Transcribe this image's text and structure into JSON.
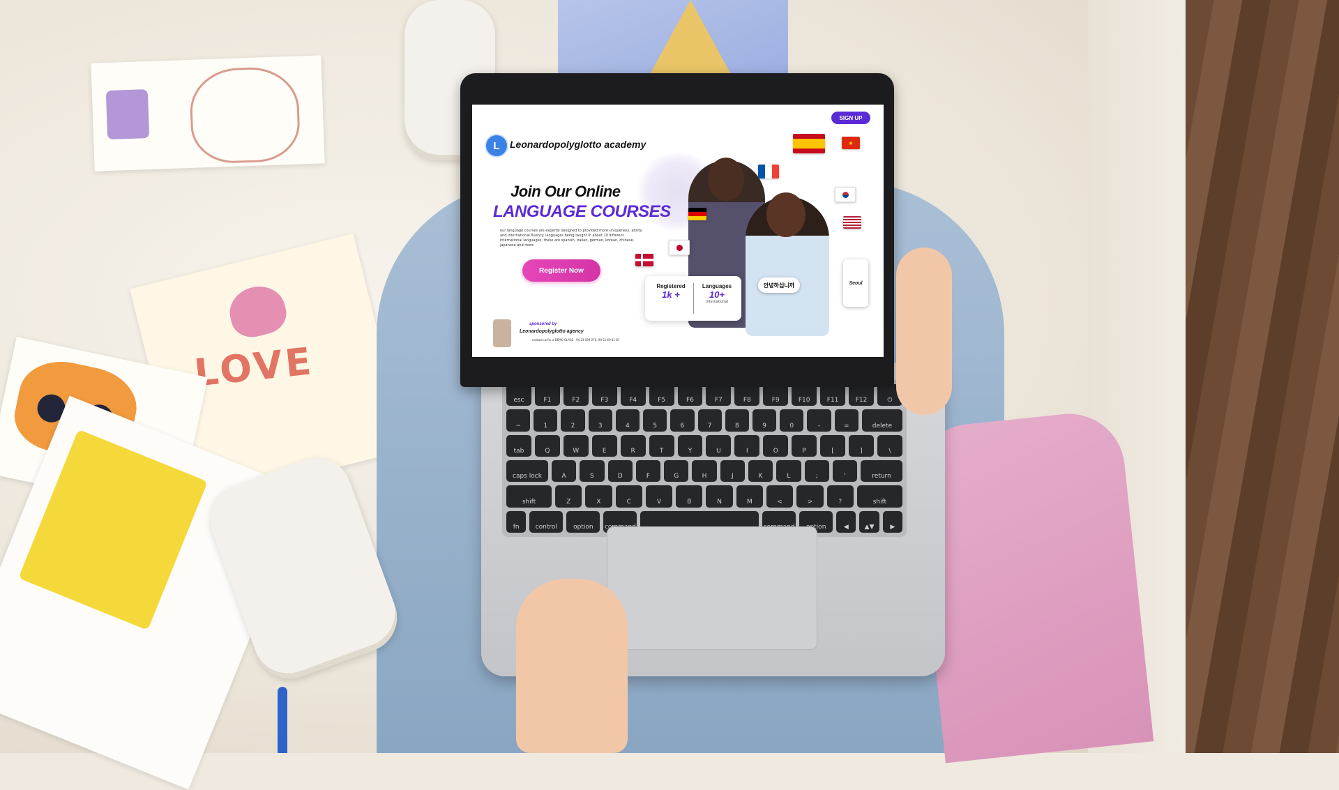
{
  "site": {
    "logo_letter": "L",
    "brand_name": "Leonardopolyglotto academy",
    "signup_label": "SIGN UP"
  },
  "hero": {
    "headline_1": "Join Our Online",
    "headline_2": "LANGUAGE COURSES",
    "description": "our language courses are expertly designed to provided more uniqueness, ability and international fluency. languages being taught in about 10 different international languages. these are spanish, italian, german, korean, chinese, japanese and more",
    "register_label": "Register Now"
  },
  "stats": {
    "registered_label": "Registered",
    "registered_value": "1k +",
    "languages_label": "Languages",
    "languages_value": "10+",
    "languages_sub": "international"
  },
  "speech_bubble": "안녕하십니까",
  "phone_text": "Seoul",
  "flags": {
    "es": "spain-flag",
    "cn": "china-flag",
    "fr": "france-flag",
    "kr": "korea-flag",
    "de": "germany-flag",
    "us": "usa-flag",
    "jp": "japan-flag",
    "dk": "denmark-flag"
  },
  "sponsor": {
    "label": "sponsored by",
    "name": "Leonardopolyglotto agency",
    "contact": "contact us for a DEMO CLASS - 94 23 599 270, 90 51 69 81 87"
  },
  "keyboard": {
    "rows": [
      [
        "esc",
        "F1",
        "F2",
        "F3",
        "F4",
        "F5",
        "F6",
        "F7",
        "F8",
        "F9",
        "F10",
        "F11",
        "F12",
        "⏻"
      ],
      [
        "~",
        "1",
        "2",
        "3",
        "4",
        "5",
        "6",
        "7",
        "8",
        "9",
        "0",
        "-",
        "=",
        "delete"
      ],
      [
        "tab",
        "Q",
        "W",
        "E",
        "R",
        "T",
        "Y",
        "U",
        "I",
        "O",
        "P",
        "[",
        "]",
        "\\"
      ],
      [
        "caps lock",
        "A",
        "S",
        "D",
        "F",
        "G",
        "H",
        "J",
        "K",
        "L",
        ";",
        "'",
        "return"
      ],
      [
        "shift",
        "Z",
        "X",
        "C",
        "V",
        "B",
        "N",
        "M",
        "<",
        ">",
        "?",
        "shift"
      ],
      [
        "fn",
        "control",
        "option",
        "command",
        "",
        "command",
        "option",
        "◀",
        "▲▼",
        "▶"
      ]
    ]
  },
  "colors": {
    "accent_purple": "#5b2bd6",
    "button_pink": "#e546b8"
  }
}
